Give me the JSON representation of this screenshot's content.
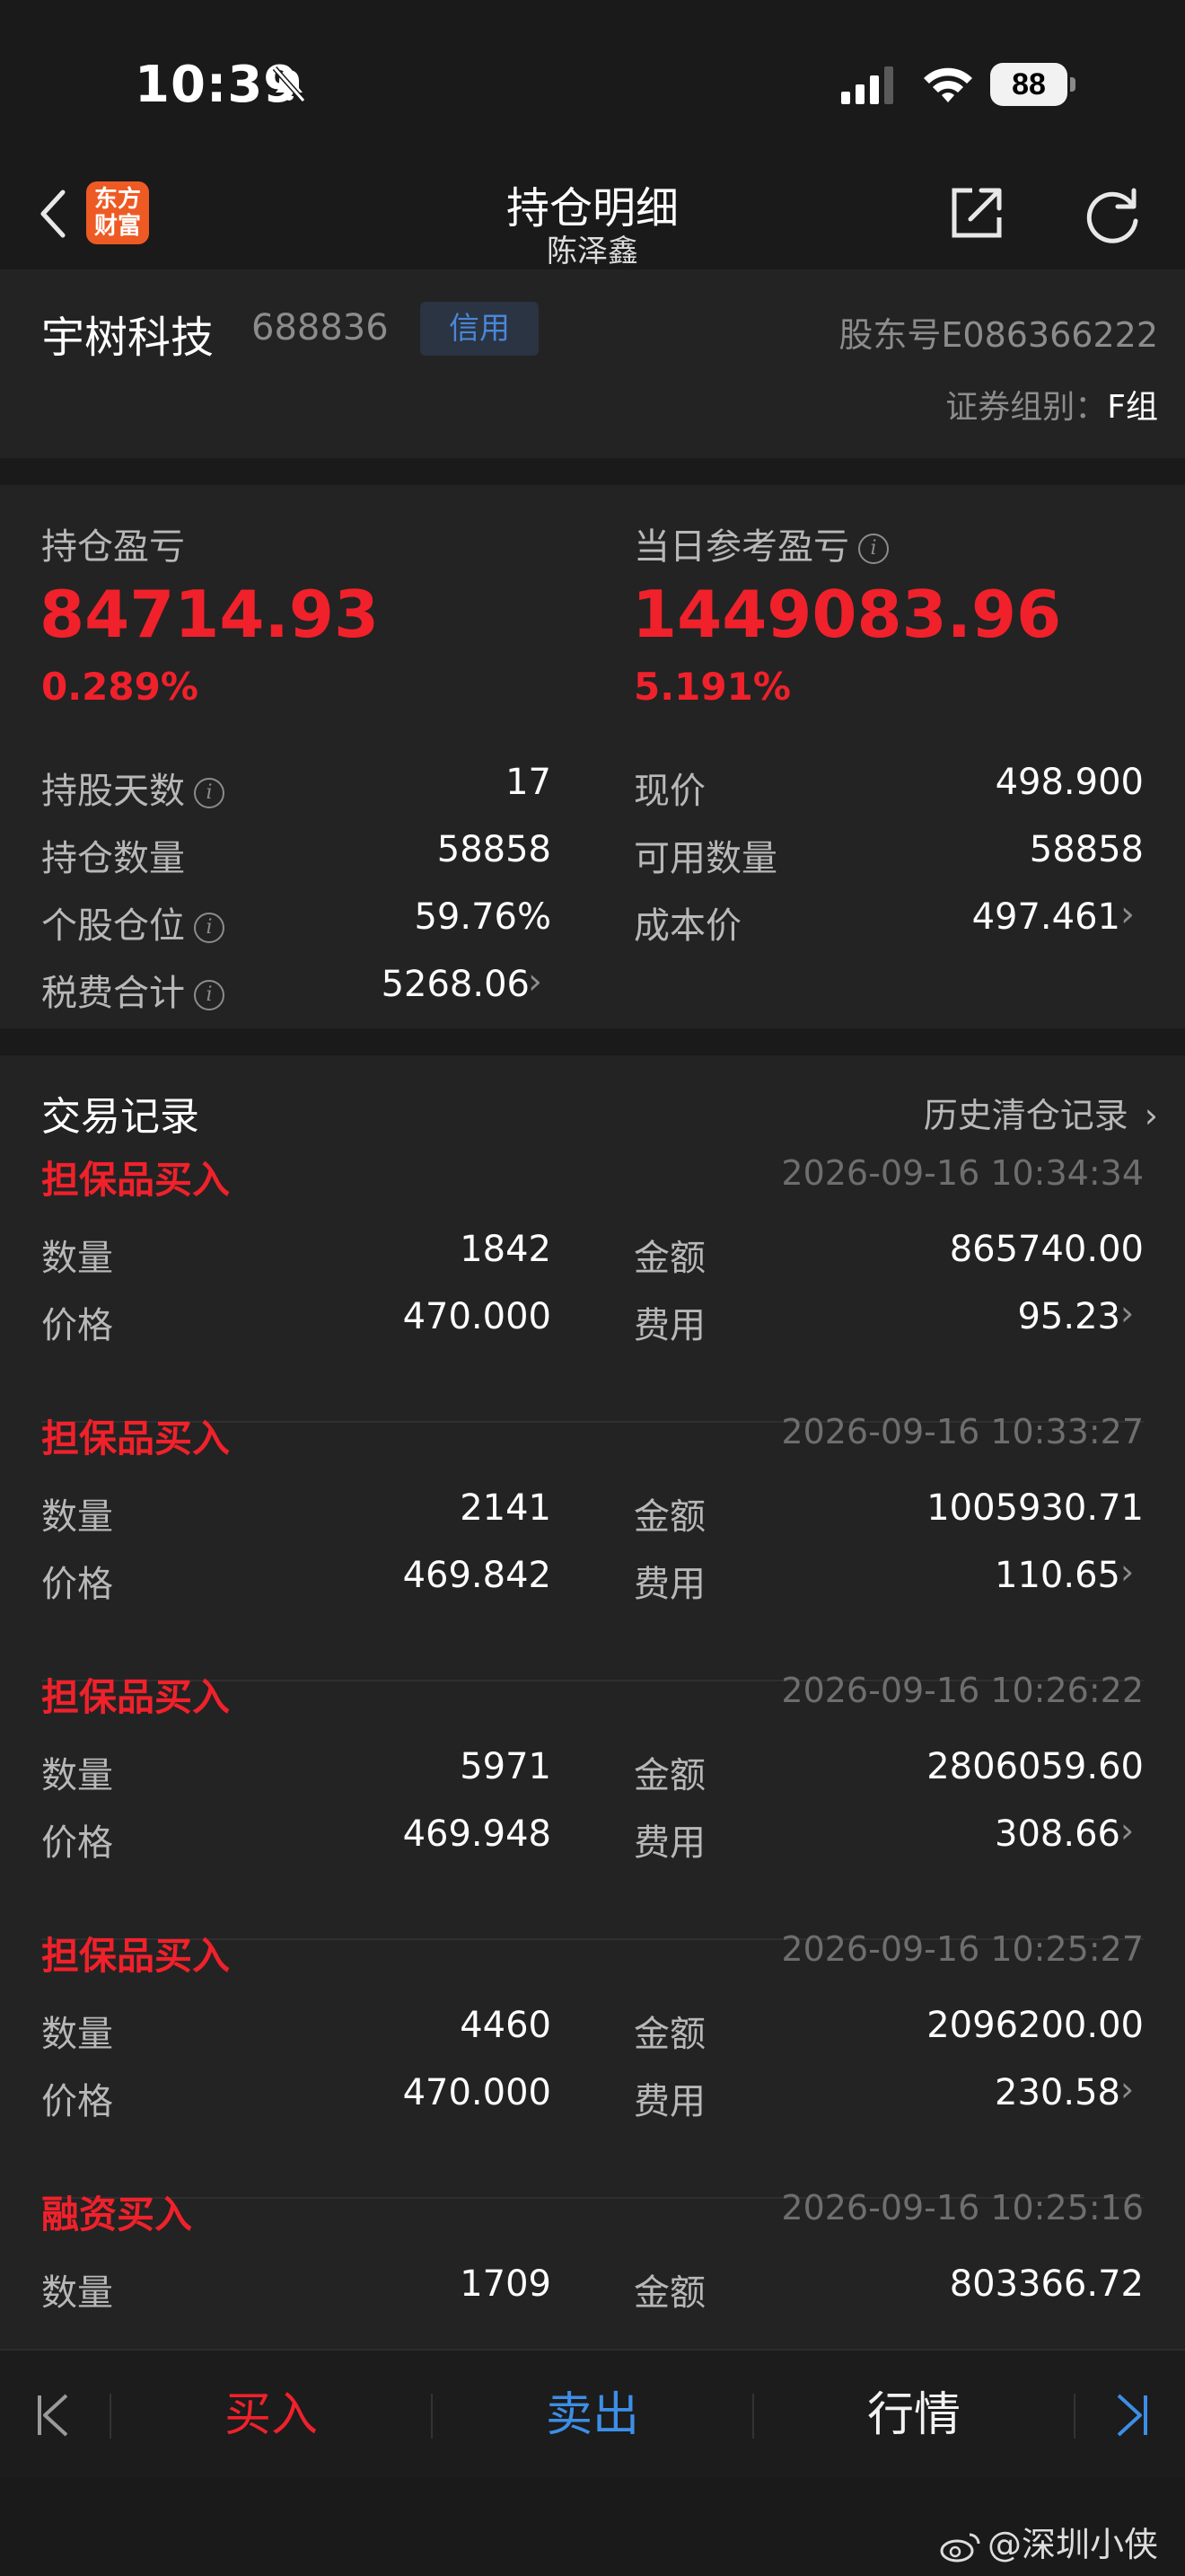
{
  "status_bar": {
    "time": "10:39",
    "battery": "88"
  },
  "header": {
    "logo_line1": "东方",
    "logo_line2": "财富",
    "title": "持仓明细",
    "subtitle": "陈泽鑫"
  },
  "stock": {
    "name": "宇树科技",
    "code": "688836",
    "badge": "信用",
    "holder_label": "股东号",
    "holder_value": "E086366222",
    "group_label": "证券组别：",
    "group_value": "F组"
  },
  "summary": {
    "position_pl_label": "持仓盈亏",
    "position_pl_value": "84714.93",
    "position_pl_pct": "0.289%",
    "daily_pl_label": "当日参考盈亏",
    "daily_pl_value": "1449083.96",
    "daily_pl_pct": "5.191%",
    "left_rows": [
      {
        "label": "持股天数",
        "value": "17"
      },
      {
        "label": "持仓数量",
        "value": "58858"
      },
      {
        "label": "个股仓位",
        "value": "59.76%"
      },
      {
        "label": "税费合计",
        "value": "5268.06"
      }
    ],
    "right_rows": [
      {
        "label": "现价",
        "value": "498.900"
      },
      {
        "label": "可用数量",
        "value": "58858"
      },
      {
        "label": "成本价",
        "value": "497.461"
      }
    ]
  },
  "trades": {
    "title": "交易记录",
    "history_link": "历史清仓记录",
    "labels": {
      "qty": "数量",
      "price": "价格",
      "amount": "金额",
      "fee": "费用"
    },
    "records": [
      {
        "type": "担保品买入",
        "time": "2026-09-16 10:34:34",
        "qty": "1842",
        "price": "470.000",
        "amount": "865740.00",
        "fee": "95.23"
      },
      {
        "type": "担保品买入",
        "time": "2026-09-16 10:33:27",
        "qty": "2141",
        "price": "469.842",
        "amount": "1005930.71",
        "fee": "110.65"
      },
      {
        "type": "担保品买入",
        "time": "2026-09-16 10:26:22",
        "qty": "5971",
        "price": "469.948",
        "amount": "2806059.60",
        "fee": "308.66"
      },
      {
        "type": "担保品买入",
        "time": "2026-09-16 10:25:27",
        "qty": "4460",
        "price": "470.000",
        "amount": "2096200.00",
        "fee": "230.58"
      },
      {
        "type": "融资买入",
        "time": "2026-09-16 10:25:16",
        "qty": "1709",
        "price": "",
        "amount": "803366.72",
        "fee": ""
      }
    ]
  },
  "bottom_bar": {
    "buy": "买入",
    "sell": "卖出",
    "market": "行情"
  },
  "watermark": "@深圳小侠",
  "colors": {
    "red": "#f0212b",
    "blue": "#3d8ee6",
    "background": "#1a1a1a",
    "card": "#232323"
  }
}
